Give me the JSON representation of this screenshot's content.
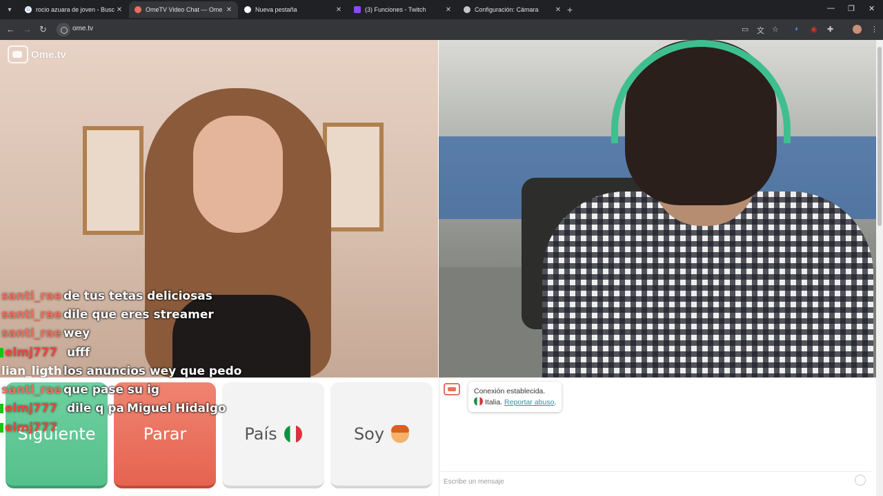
{
  "browser": {
    "tabs": [
      {
        "title": "rocio azuara de joven - Buscar",
        "close": "✕",
        "favicon_color": "#ffffff"
      },
      {
        "title": "OmeTV Video Chat — Ome",
        "close": "✕",
        "favicon_color": "#e8705d"
      },
      {
        "title": "Nueva pestaña",
        "close": "✕",
        "favicon_color": "#ffffff"
      },
      {
        "title": "(3) Funciones - Twitch",
        "close": "✕",
        "favicon_color": "#9146ff"
      },
      {
        "title": "Configuración: Cámara",
        "close": "✕",
        "favicon_color": "#c4c7c5"
      }
    ],
    "new_tab": "+",
    "url": "ome.tv",
    "window_controls": {
      "minimize": "—",
      "maximize": "❐",
      "close": "✕"
    }
  },
  "logo": {
    "text": "Ome.tv"
  },
  "chat_overlay": [
    {
      "user": "santi_rae",
      "msg": "de tus tetas deliciosas",
      "color": "#e8705d",
      "badge": false
    },
    {
      "user": "santi_rae",
      "msg": "dile que eres streamer",
      "color": "#e8705d",
      "badge": false
    },
    {
      "user": "santi_rae",
      "msg": "wey",
      "color": "#e8705d",
      "badge": false
    },
    {
      "user": "elmj777",
      "msg": "ufff",
      "color": "#e8483a",
      "badge": true
    },
    {
      "user": "lian_ligth",
      "msg": "los anuncios wey que pedo",
      "color": "#ffffff",
      "badge": false
    },
    {
      "user": "santi_rae",
      "msg": "que pase su ig",
      "color": "#e8705d",
      "badge": false
    },
    {
      "user": "elmj777",
      "msg": "dile q pa",
      "color": "#e8483a",
      "badge": true
    },
    {
      "user": "elmj777",
      "msg": "",
      "color": "#e8483a",
      "badge": true
    }
  ],
  "overlay_extra": "Miguel Hidalgo",
  "buttons": {
    "next": "Siguiente",
    "stop": "Parar",
    "country": "País",
    "gender": "Soy"
  },
  "chat": {
    "status": "Conexión establecida.",
    "country": "Italia.",
    "report": "Reportar abuso",
    "input_placeholder": "Escribe un mensaje"
  }
}
